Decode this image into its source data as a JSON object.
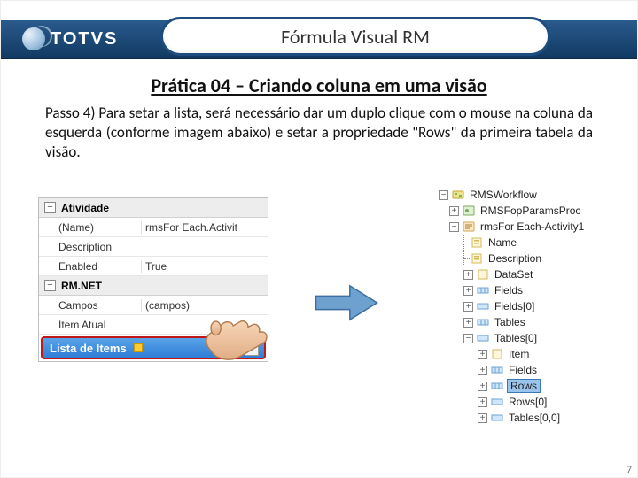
{
  "header": {
    "brand": "TOTVS",
    "title": "Fórmula Visual RM"
  },
  "subtitle": "Prática 04 – Criando coluna em uma visão",
  "body": "Passo 4)  Para setar a lista, será necessário dar um duplo clique com o mouse na coluna da esquerda (conforme imagem abaixo)  e setar a propriedade \"Rows\" da primeira tabela da visão.",
  "propgrid": {
    "cat1": "Atividade",
    "rows1": [
      {
        "k": "(Name)",
        "v": "rmsFor Each.Activit"
      },
      {
        "k": "Description",
        "v": ""
      },
      {
        "k": "Enabled",
        "v": "True"
      }
    ],
    "cat2": "RM.NET",
    "rows2": [
      {
        "k": "Campos",
        "v": "(campos)"
      },
      {
        "k": "Item Atual",
        "v": ""
      }
    ],
    "selected_label": "Lista de Items"
  },
  "tree": {
    "n0": "RMSWorkflow",
    "n1": "RMSFopParamsProc",
    "n2": "rmsFor Each-Activity1",
    "n3": "Name",
    "n4": "Description",
    "n5": "DataSet",
    "n6": "Fields",
    "n7": "Fields[0]",
    "n8": "Tables",
    "n9": "Tables[0]",
    "n10": "Item",
    "n11": "Fields",
    "n12": "Rows",
    "n13": "Rows[0]",
    "n14": "Tables[0,0]"
  },
  "page_number": "7"
}
